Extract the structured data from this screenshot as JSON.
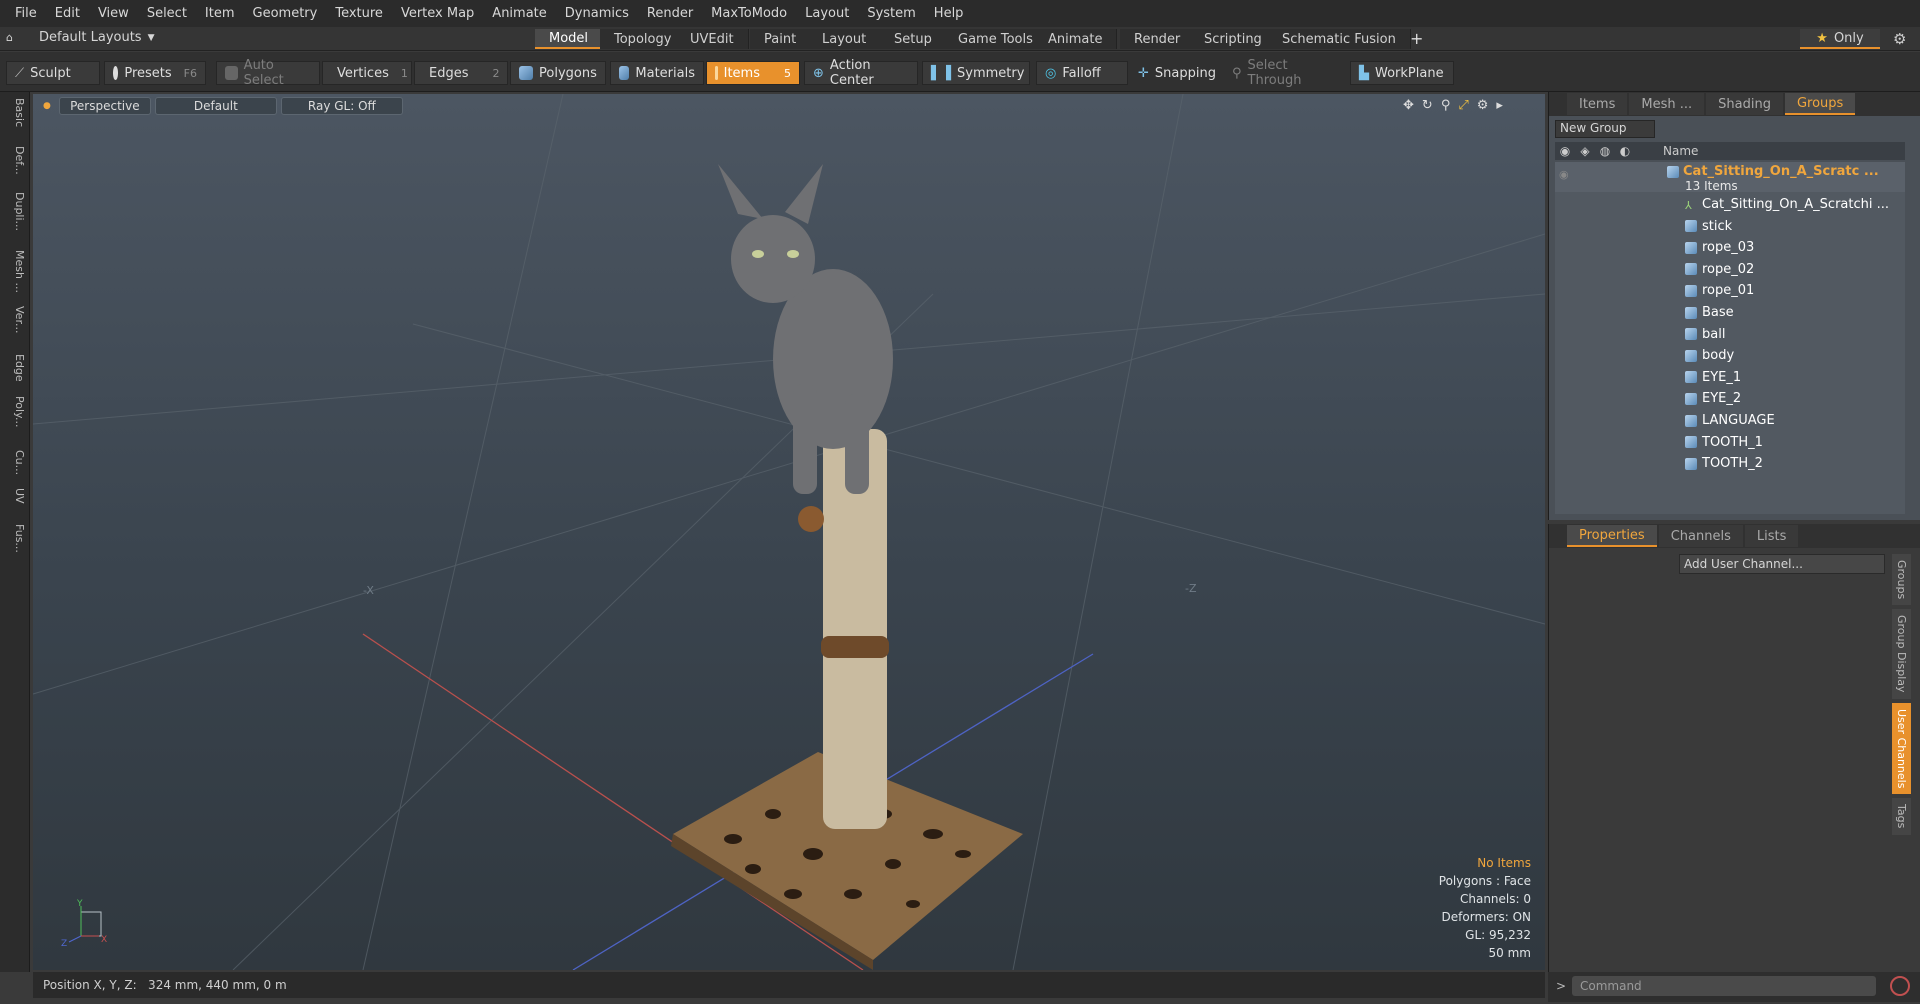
{
  "menu": [
    "File",
    "Edit",
    "View",
    "Select",
    "Item",
    "Geometry",
    "Texture",
    "Vertex Map",
    "Animate",
    "Dynamics",
    "Render",
    "MaxToModo",
    "Layout",
    "System",
    "Help"
  ],
  "layouts_label": "Default Layouts",
  "context_tabs": [
    "Model",
    "Topology",
    "UVEdit",
    "Paint",
    "Layout",
    "Setup",
    "Game Tools",
    "Animate",
    "Render",
    "Scripting",
    "Schematic Fusion"
  ],
  "context_active": "Model",
  "only_label": "Only",
  "toolbar": {
    "sculpt": "Sculpt",
    "presets": "Presets",
    "presets_key": "F6",
    "auto_select": "Auto Select",
    "vertices": "Vertices",
    "vertices_count": "1",
    "edges": "Edges",
    "edges_count": "2",
    "polygons": "Polygons",
    "materials": "Materials",
    "items": "Items",
    "items_count": "5",
    "action_center": "Action Center",
    "symmetry": "Symmetry",
    "falloff": "Falloff",
    "snapping": "Snapping",
    "select_through": "Select Through",
    "workplane": "WorkPlane"
  },
  "left_tabs": [
    "Basic",
    "Def...",
    "Dupli...",
    "Mesh ...",
    "Ver...",
    "Edge",
    "Poly...",
    "Cu...",
    "UV",
    "Fus..."
  ],
  "viewport": {
    "view": "Perspective",
    "style": "Default",
    "raygl": "Ray GL: Off",
    "axis_x": "X",
    "axis_y": "Y",
    "axis_z": "Z",
    "stats": {
      "no_items": "No Items",
      "polygons": "Polygons : Face",
      "channels": "Channels: 0",
      "deformers": "Deformers: ON",
      "gl": "GL: 95,232",
      "scale": "50 mm"
    }
  },
  "status": "Position X, Y, Z:   324 mm, 440 mm, 0 m",
  "right_tabs": [
    "Items",
    "Mesh ...",
    "Shading",
    "Groups"
  ],
  "right_active": "Groups",
  "new_group": "New Group",
  "name_header": "Name",
  "group": {
    "name": "Cat_Sitting_On_A_Scratc ...",
    "count": "13 Items",
    "children": [
      "Cat_Sitting_On_A_Scratchi ...",
      "stick",
      "rope_03",
      "rope_02",
      "rope_01",
      "Base",
      "ball",
      "body",
      "EYE_1",
      "EYE_2",
      "LANGUAGE",
      "TOOTH_1",
      "TOOTH_2"
    ]
  },
  "props_tabs": [
    "Properties",
    "Channels",
    "Lists"
  ],
  "props_active": "Properties",
  "add_user_channel": "Add User Channel...",
  "side_tabs": [
    "Groups",
    "Group Display",
    "User Channels",
    "Tags"
  ],
  "side_active": "User Channels",
  "command_placeholder": "Command",
  "colors": {
    "accent": "#e8912c",
    "selected_text": "#f0a63d"
  }
}
